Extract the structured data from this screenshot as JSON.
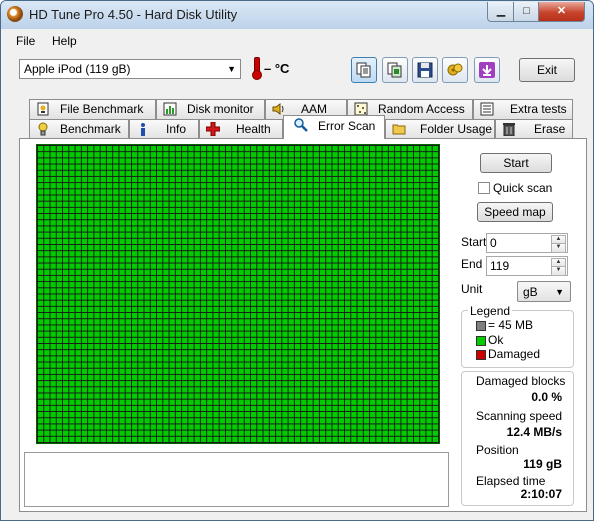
{
  "window": {
    "title": "HD Tune Pro 4.50 - Hard Disk Utility",
    "minimize": "▁",
    "maximize": "□",
    "close": "✕"
  },
  "menu": {
    "file": "File",
    "help": "Help"
  },
  "toolbar": {
    "drive": "Apple   iPod          (119 gB)",
    "temperature": "– °C",
    "exit_label": "Exit",
    "icons": [
      "copy-text-icon",
      "copy-screenshot-icon",
      "save-icon",
      "options-icon",
      "download-icon"
    ]
  },
  "tabs_row1": [
    {
      "label": "File Benchmark",
      "icon": "file-benchmark-icon"
    },
    {
      "label": "Disk monitor",
      "icon": "disk-monitor-icon"
    },
    {
      "label": "AAM",
      "icon": "speaker-icon"
    },
    {
      "label": "Random Access",
      "icon": "random-access-icon"
    },
    {
      "label": "Extra tests",
      "icon": "extra-tests-icon"
    }
  ],
  "tabs_row2": [
    {
      "label": "Benchmark",
      "icon": "benchmark-icon"
    },
    {
      "label": "Info",
      "icon": "info-icon"
    },
    {
      "label": "Health",
      "icon": "health-cross-icon"
    },
    {
      "label": "Error Scan",
      "icon": "magnifier-icon",
      "selected": true
    },
    {
      "label": "Folder Usage",
      "icon": "folder-icon"
    },
    {
      "label": "Erase",
      "icon": "trash-icon"
    }
  ],
  "scan": {
    "start_button": "Start",
    "quick_scan_label": "Quick scan",
    "quick_scan_checked": false,
    "speed_map_button": "Speed map",
    "start_label": "Start",
    "start_value": "0",
    "end_label": "End",
    "end_value": "119",
    "unit_label": "Unit",
    "unit_value": "gB"
  },
  "legend": {
    "title": "Legend",
    "block_size": "= 45 MB",
    "ok": "Ok",
    "damaged": "Damaged",
    "colors": {
      "block": "#808080",
      "ok": "#00cc00",
      "damaged": "#cc0000"
    }
  },
  "stats": {
    "damaged_blocks_label": "Damaged blocks",
    "damaged_blocks_value": "0.0 %",
    "scanning_speed_label": "Scanning speed",
    "scanning_speed_value": "12.4 MB/s",
    "position_label": "Position",
    "position_value": "119 gB",
    "elapsed_time_label": "Elapsed time",
    "elapsed_time_value": "2:10:07"
  }
}
